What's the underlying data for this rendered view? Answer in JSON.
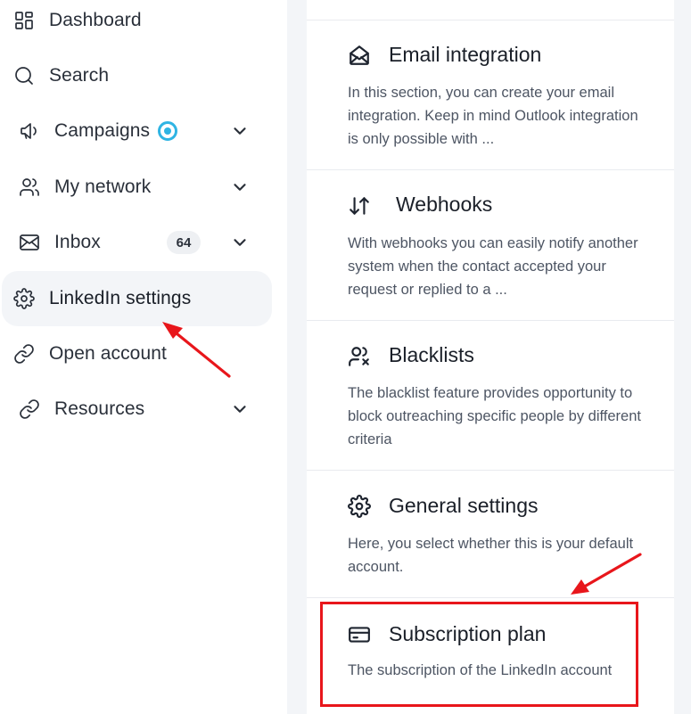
{
  "sidebar": {
    "items": [
      {
        "label": "Dashboard",
        "icon": "dashboard-icon",
        "chevron": false
      },
      {
        "label": "Search",
        "icon": "search-icon",
        "chevron": false
      },
      {
        "label": "Campaigns",
        "icon": "megaphone-icon",
        "chevron": true,
        "status_dot": true
      },
      {
        "label": "My network",
        "icon": "users-icon",
        "chevron": true
      },
      {
        "label": "Inbox",
        "icon": "mail-icon",
        "chevron": true,
        "count": "64"
      },
      {
        "label": "LinkedIn settings",
        "icon": "gear-icon",
        "chevron": false,
        "active": true
      },
      {
        "label": "Open account",
        "icon": "link-icon",
        "chevron": false
      },
      {
        "label": "Resources",
        "icon": "link-icon",
        "chevron": true
      }
    ]
  },
  "settings": {
    "cards": [
      {
        "title": "Email integration",
        "icon": "envelope-open-icon",
        "description": "In this section, you can create your email integration. Keep in mind Outlook integration is only possible with ..."
      },
      {
        "title": "Webhooks",
        "icon": "arrows-up-down-icon",
        "description": "With webhooks you can easily notify another system when the contact accepted your request or replied to a ..."
      },
      {
        "title": "Blacklists",
        "icon": "user-blocked-icon",
        "description": "The blacklist feature provides opportunity to block outreaching specific people by different criteria"
      },
      {
        "title": "General settings",
        "icon": "gear-icon",
        "description": "Here, you select whether this is your default account."
      },
      {
        "title": "Subscription plan",
        "icon": "credit-card-icon",
        "description": "The subscription of the LinkedIn account"
      }
    ]
  },
  "colors": {
    "accent": "#2fb4e3",
    "annotation": "#e8161b",
    "active_bg": "#f3f5f8"
  }
}
